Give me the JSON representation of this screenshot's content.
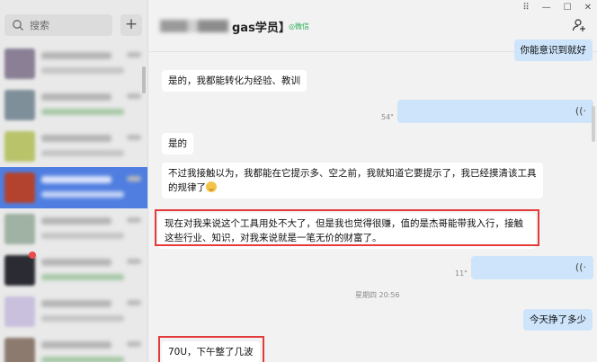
{
  "sidebar": {
    "search_placeholder": "搜索",
    "add_label": "+",
    "chats": [
      {
        "avatar_color": "#8a7f94",
        "active": false,
        "badge": false
      },
      {
        "avatar_color": "#7f8f9a",
        "active": false,
        "badge": false
      },
      {
        "avatar_color": "#b9c46a",
        "active": false,
        "badge": false
      },
      {
        "avatar_color": "#b3432f",
        "active": true,
        "badge": false
      },
      {
        "avatar_color": "#9fb2a3",
        "active": false,
        "badge": false
      },
      {
        "avatar_color": "#2b2b33",
        "active": false,
        "badge": true
      },
      {
        "avatar_color": "#c9c0de",
        "active": false,
        "badge": false
      },
      {
        "avatar_color": "#8c7a6e",
        "active": false,
        "badge": false
      }
    ]
  },
  "header": {
    "title_suffix": "gas学员】",
    "wechat_badge": "◎微信",
    "window_controls": [
      "⠿",
      "—",
      "☐",
      "✕"
    ]
  },
  "messages": {
    "m0": "你能意识到就好",
    "m1": "是的，我都能转化为经验、教训",
    "m2_duration": "54\"",
    "m3": "是的",
    "m4": "不过我接触以为，我都能在它提示多、空之前，我就知道它要提示了，我已经摸清该工具的规律了",
    "m5": "现在对我来说这个工具用处不大了，但是我也觉得很赚，值的是杰哥能带我入行，接触这些行业、知识，对我来说就是一笔无价的财富了。",
    "m6_duration": "11\"",
    "timestamp": "星期四 20:56",
    "m7": "今天挣了多少",
    "m8": "70U，下午整了几波"
  },
  "colors": {
    "accent": "#4f7ee0",
    "bubble_out": "#cde4fb",
    "bubble_in": "#ffffff",
    "highlight": "#e43a3a",
    "wechat_green": "#2bae5b"
  }
}
